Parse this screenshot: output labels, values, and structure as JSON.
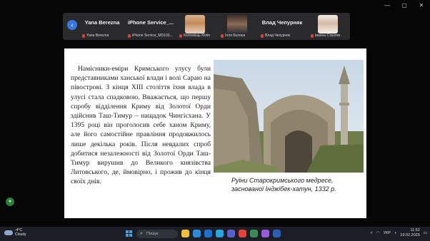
{
  "window": {
    "min": "—",
    "max": "▢",
    "close": "✕"
  },
  "meeting": {
    "nav_icon": "chevron-left-icon",
    "participants": [
      {
        "big": "Yana Berezna",
        "small": "Yana Berezna"
      },
      {
        "big": "iPhone Service_...",
        "small": "iPhone Service_MD103..."
      },
      {
        "small": "Коломієць Юлія"
      },
      {
        "small": "Ілля Бєляєв"
      },
      {
        "big": "Влад Чепурняк",
        "small": "Влад Чепурняк"
      },
      {
        "small": "Іванна Строгов"
      }
    ]
  },
  "slide": {
    "paragraph": "Намісники-еміри Кримського улусу були представниками ханської влади і волі Сараю на півострові. З кінця XIII століття їхня влада в улусі стала спадковою. Вважається, що першу спробу відділення Криму від Золотої Орди здійснив Таш-Тимур – нащадок Чингісхана. У 1395 році він проголосив себе ханом Криму, але його самостійне правління продовжилось лише декілька років. Після невдалих спроб добитися незалежності від Золотої Орди Таш-Тимур вирушив до Великого князівства Литовського, де, ймовірно, і прожив до кінця своїх днів.",
    "caption": "Руїни Старокримського медресе, заснованої Інджібек-хатун, 1332 р."
  },
  "taskbar": {
    "temp": "-4°C",
    "weather": "Cloudy",
    "search_placeholder": "Пошук",
    "lang": "УКР",
    "time": "11:52",
    "date": "19.02.2025"
  },
  "colors": {
    "accent": "#3a78e0",
    "mic_muted": "#e04040",
    "taskbar": "#1b1e25"
  }
}
